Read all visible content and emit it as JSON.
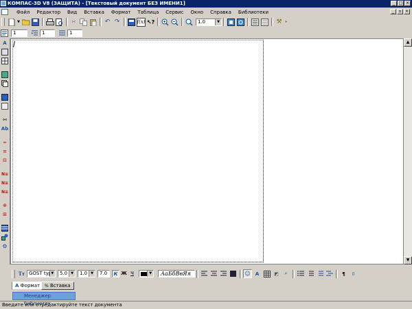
{
  "window": {
    "title": "КОМПАС-3D V8 (ЗАЩИТА) - [Текстовый документ БЕЗ ИМЕНИ1]"
  },
  "menu": {
    "items": [
      "Файл",
      "Редактор",
      "Вид",
      "Вставка",
      "Формат",
      "Таблица",
      "Сервис",
      "Окно",
      "Справка",
      "Библиотеки"
    ]
  },
  "toolbar": {
    "zoom_value": "1.0"
  },
  "params_bar": {
    "field1": "1",
    "field2": "1",
    "field3": "1"
  },
  "format_bar": {
    "font_name": "GOST type",
    "font_size": "5.0",
    "line_spacing": "1.0",
    "char_size": "7.0",
    "bold_label": "Ж",
    "italic_label": "К",
    "underline_label": "Ч",
    "sample_text": "АаБбВвЯя"
  },
  "tabs": [
    {
      "label": "Формат",
      "active": true
    },
    {
      "label": "Вставка",
      "active": false
    }
  ],
  "library": {
    "manager_label": "Менеджер библиотек"
  },
  "status": {
    "text": "Введите или отредактируйте текст документа"
  },
  "colors": {
    "title_bg": "#0a246a",
    "library_tab": "#6ea0e0"
  }
}
